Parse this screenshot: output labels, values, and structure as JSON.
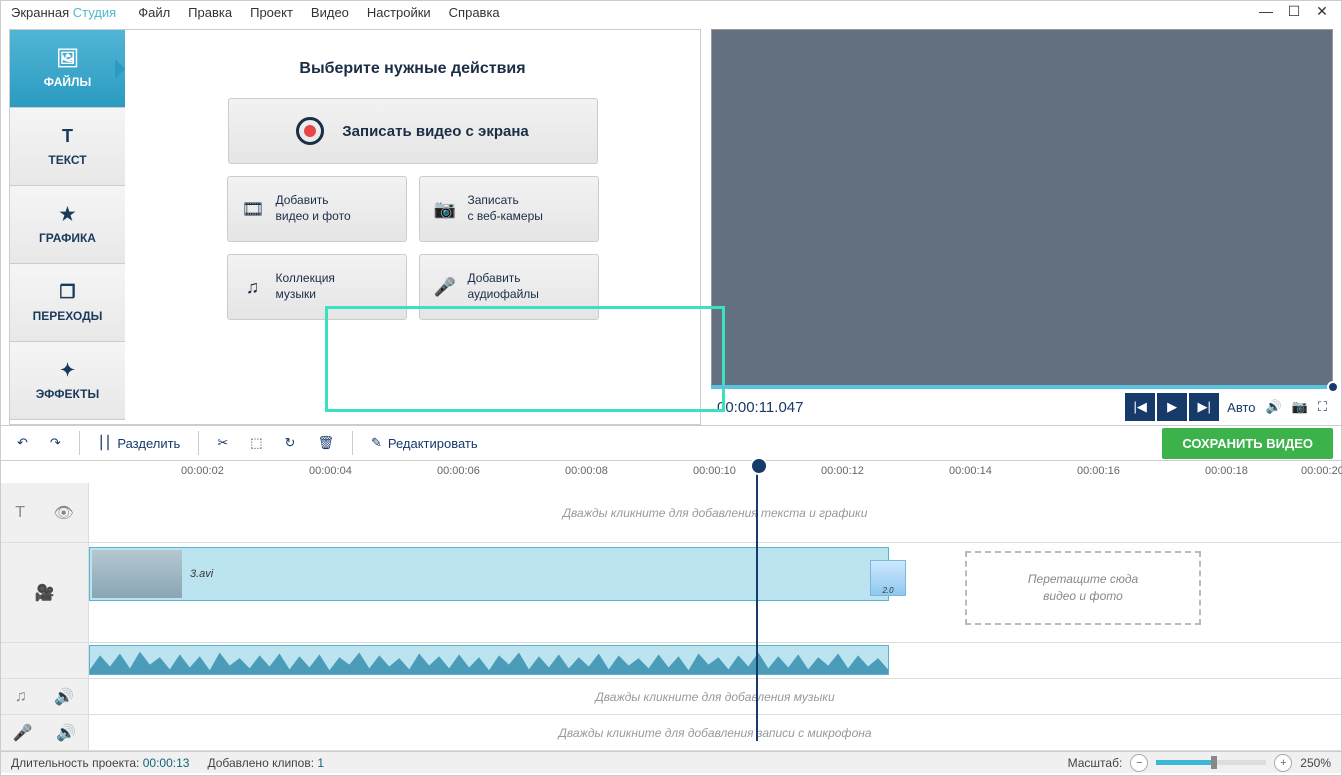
{
  "app": {
    "title1": "Экранная",
    "title2": "Студия"
  },
  "menu": {
    "items": [
      "Файл",
      "Правка",
      "Проект",
      "Видео",
      "Настройки",
      "Справка"
    ]
  },
  "sidebar": {
    "tabs": [
      {
        "label": "ФАЙЛЫ",
        "icon": "🖼"
      },
      {
        "label": "ТЕКСТ",
        "icon": "T"
      },
      {
        "label": "ГРАФИКА",
        "icon": "★"
      },
      {
        "label": "ПЕРЕХОДЫ",
        "icon": "❐"
      },
      {
        "label": "ЭФФЕКТЫ",
        "icon": "✦"
      }
    ]
  },
  "content": {
    "title": "Выберите нужные действия",
    "record": "Записать видео с экрана",
    "grid": [
      {
        "icon": "🎞",
        "text": "Добавить\nвидео и фото"
      },
      {
        "icon": "📷",
        "text": "Записать\nс веб-камеры"
      },
      {
        "icon": "♫",
        "text": "Коллекция\nмузыки"
      },
      {
        "icon": "🎤",
        "text": "Добавить\nаудиофайлы"
      }
    ]
  },
  "preview": {
    "timecode": "00:00:11.047",
    "auto": "Авто"
  },
  "toolbar": {
    "split": "Разделить",
    "edit": "Редактировать",
    "save": "СОХРАНИТЬ ВИДЕО"
  },
  "ruler": {
    "marks": [
      "00:00:02",
      "00:00:04",
      "00:00:06",
      "00:00:08",
      "00:00:10",
      "00:00:12",
      "00:00:14",
      "00:00:16",
      "00:00:18",
      "00:00:20"
    ]
  },
  "tracks": {
    "text_hint": "Дважды кликните для добавления текста и графики",
    "music_hint": "Дважды кликните для добавления музыки",
    "mic_hint": "Дважды кликните для добавления записи с микрофона",
    "drop_hint": "Перетащите сюда\nвидео и фото",
    "clip_name": "3.avi",
    "trans_dur": "2.0"
  },
  "status": {
    "duration_label": "Длительность проекта:",
    "duration": "00:00:13",
    "clips_label": "Добавлено клипов:",
    "clips": "1",
    "zoom_label": "Масштаб:",
    "zoom": "250%"
  }
}
